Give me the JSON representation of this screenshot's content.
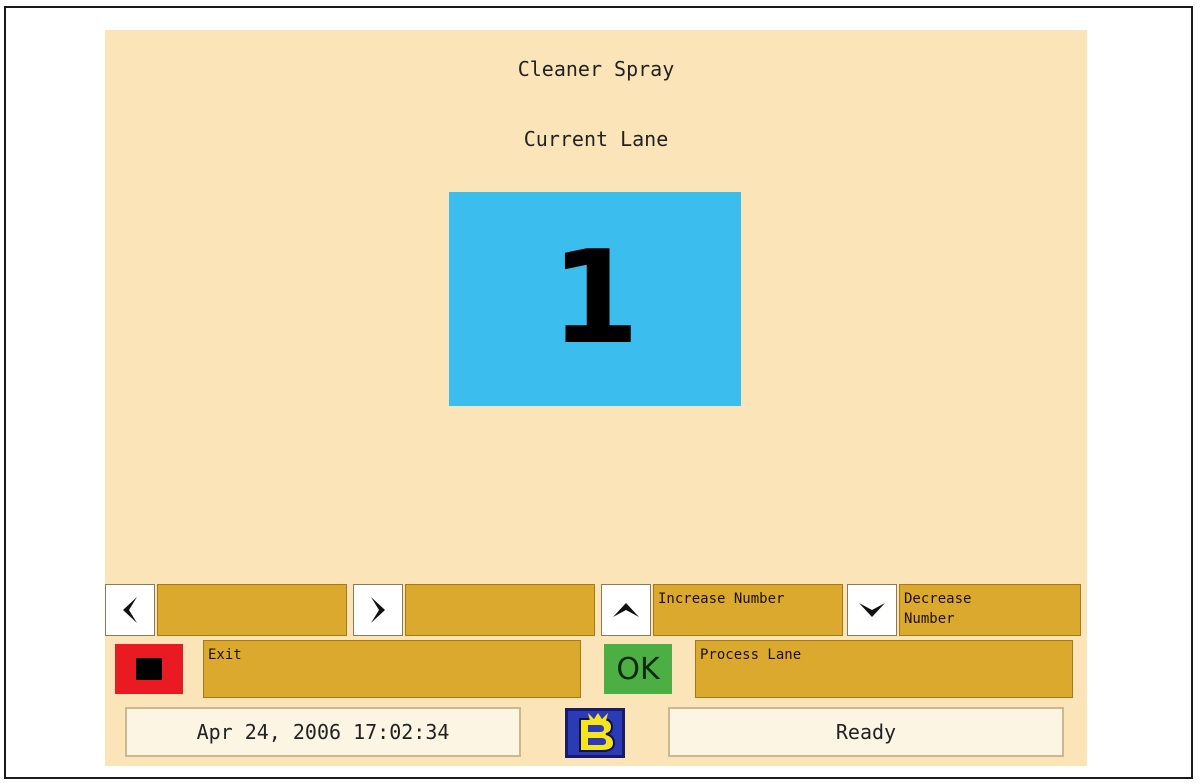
{
  "screen": {
    "title": "Cleaner Spray",
    "subtitle": "Current Lane",
    "lane_number": "1"
  },
  "softkeys": {
    "left_arrow_label": "",
    "right_arrow_label": "",
    "increase_label": "Increase Number",
    "decrease_label": "Decrease Number",
    "exit_label": "Exit",
    "ok_label": "OK",
    "process_label": "Process Lane"
  },
  "status_bar": {
    "datetime": "Apr 24, 2006 17:02:34",
    "status": "Ready"
  },
  "colors": {
    "background": "#fbe4b7",
    "lane_box": "#3bbdee",
    "softkey_label": "#dca92f",
    "exit_button": "#ea1a22",
    "ok_button": "#4caf43",
    "logo": "#2230a8"
  },
  "icons": {
    "left": "arrow-left-icon",
    "right": "arrow-right-icon",
    "up": "arrow-up-icon",
    "down": "arrow-down-icon",
    "stop": "stop-icon",
    "logo": "brand-logo"
  }
}
